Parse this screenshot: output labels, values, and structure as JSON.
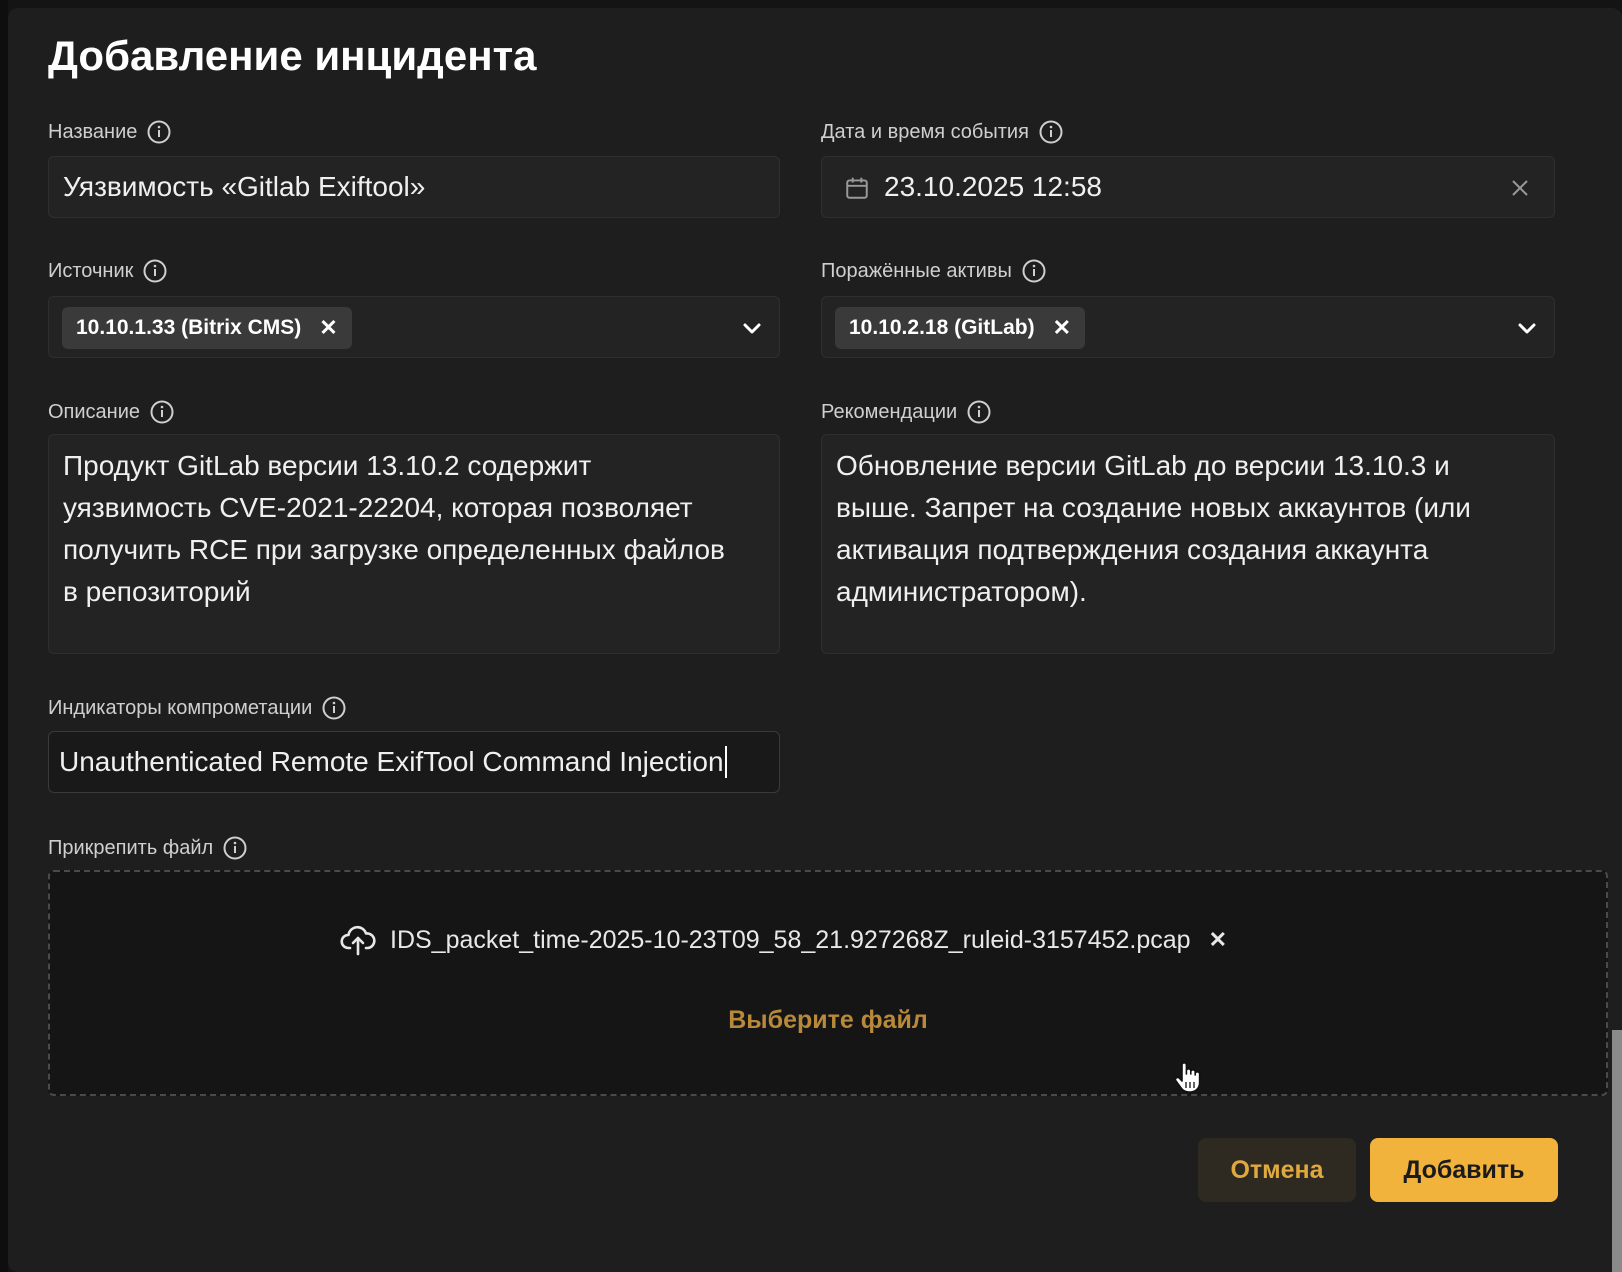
{
  "modal": {
    "title": "Добавление инцидента"
  },
  "fields": {
    "name": {
      "label": "Название",
      "value": "Уязвимость «Gitlab Exiftool»"
    },
    "datetime": {
      "label": "Дата и время события",
      "value": "23.10.2025 12:58"
    },
    "source": {
      "label": "Источник",
      "tags": [
        "10.10.1.33 (Bitrix CMS)"
      ]
    },
    "assets": {
      "label": "Поражённые активы",
      "tags": [
        "10.10.2.18 (GitLab)"
      ]
    },
    "description": {
      "label": "Описание",
      "value": "Продукт GitLab версии 13.10.2 содержит\nуязвимость CVE-2021-22204, которая позволяет\nполучить RCE при загрузке определенных файлов\nв репозиторий"
    },
    "recommendations": {
      "label": "Рекомендации",
      "value": "Обновление версии GitLab до версии 13.10.3 и\nвыше. Запрет на создание новых аккаунтов (или\nактивация подтверждения создания аккаунта\nадминистратором)."
    },
    "ioc": {
      "label": "Индикаторы компрометации",
      "value": "Unauthenticated Remote ExifTool Command Injection"
    },
    "attachment": {
      "label": "Прикрепить файл",
      "file_name": "IDS_packet_time-2025-10-23T09_58_21.927268Z_ruleid-3157452.pcap",
      "select_label": "Выберите файл"
    }
  },
  "buttons": {
    "cancel": "Отмена",
    "add": "Добавить"
  },
  "colors": {
    "accent": "#f2b33d",
    "accent_text": "#e0a93e",
    "link": "#b8893a",
    "background": "#1e1e1e"
  },
  "icons": {
    "info": "info-icon",
    "calendar": "calendar-icon",
    "clear": "close-icon",
    "chevron": "chevron-down-icon",
    "upload": "cloud-upload-icon",
    "remove": "close-icon"
  }
}
